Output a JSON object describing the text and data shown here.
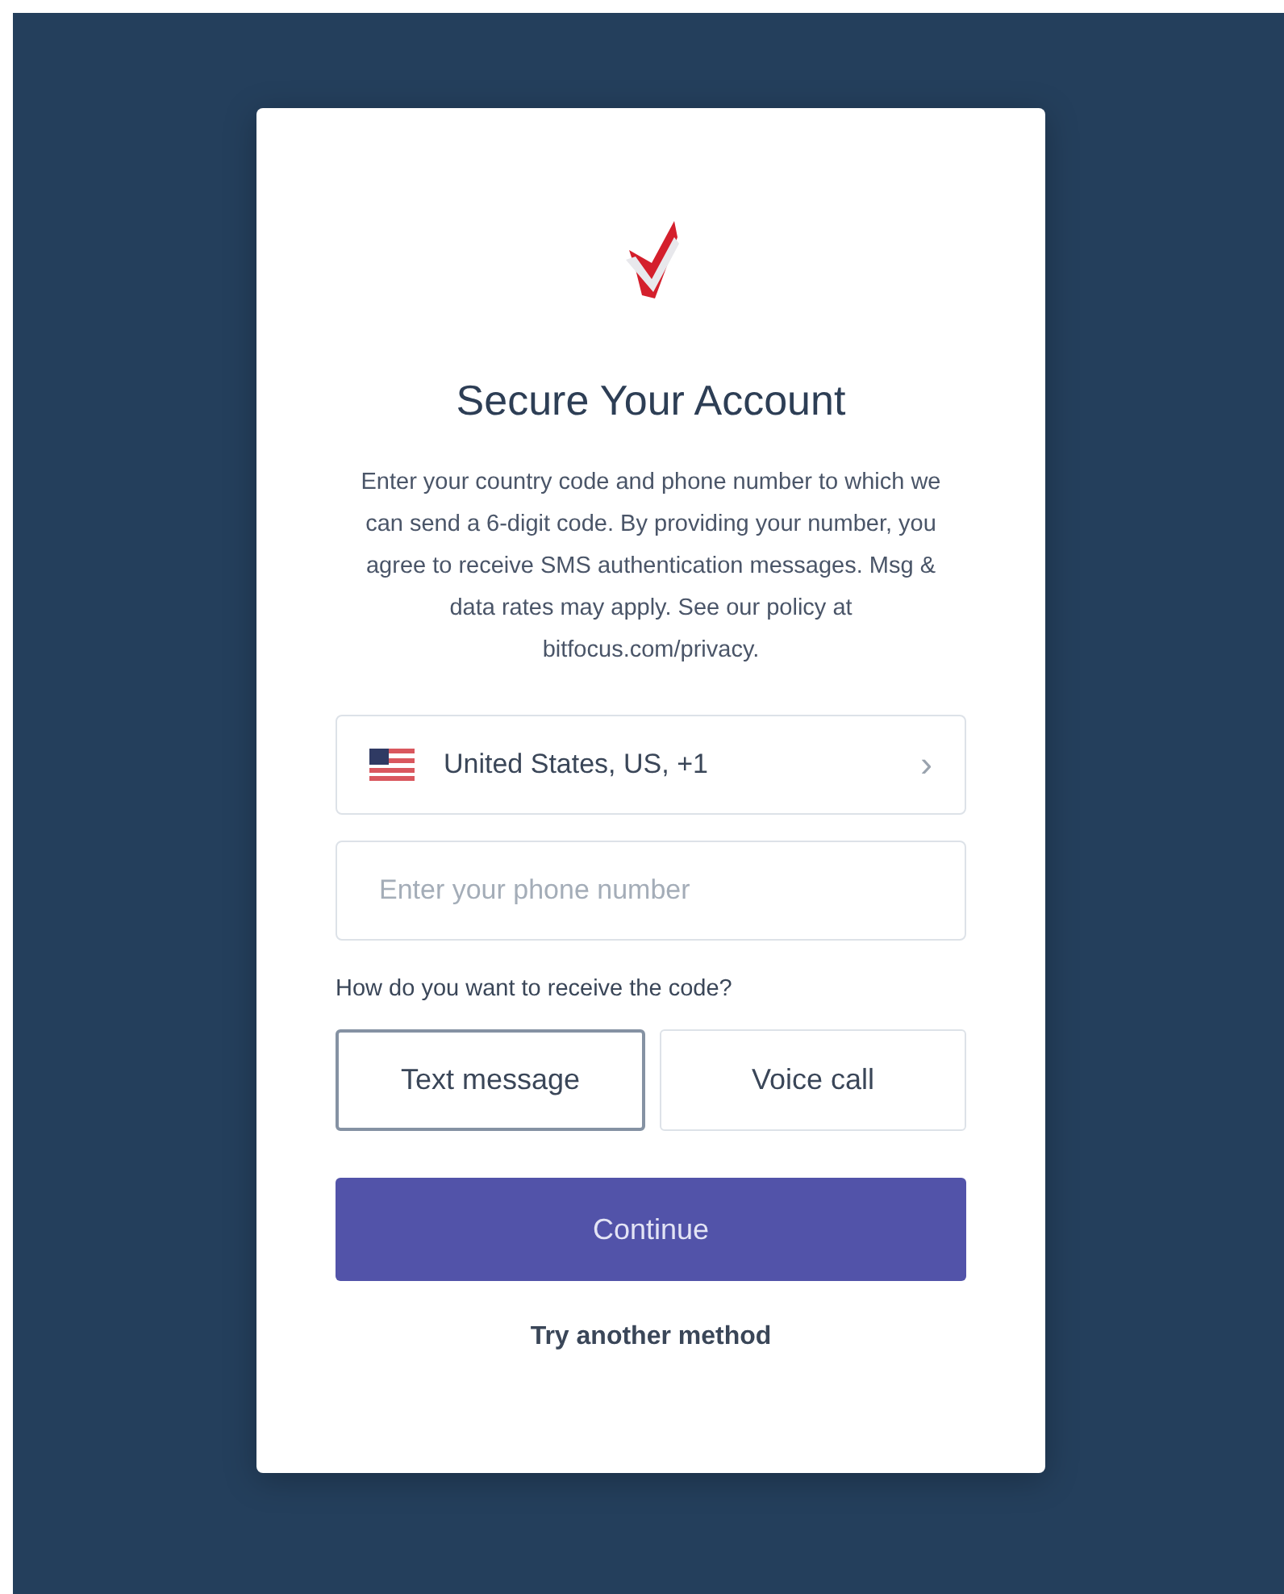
{
  "title": "Secure Your Account",
  "description": "Enter your country code and phone number to which we can send a 6-digit code. By providing your number, you agree to receive SMS authentication messages. Msg & data rates may apply. See our policy at bitfocus.com/privacy.",
  "country_select": {
    "value": "United States, US, +1",
    "chevron": "›"
  },
  "phone_field": {
    "placeholder": "Enter your phone number"
  },
  "method_prompt": "How do you want to receive the code?",
  "methods": [
    {
      "label": "Text message",
      "selected": true
    },
    {
      "label": "Voice call",
      "selected": false
    }
  ],
  "continue_button": "Continue",
  "alt_link": "Try another method"
}
